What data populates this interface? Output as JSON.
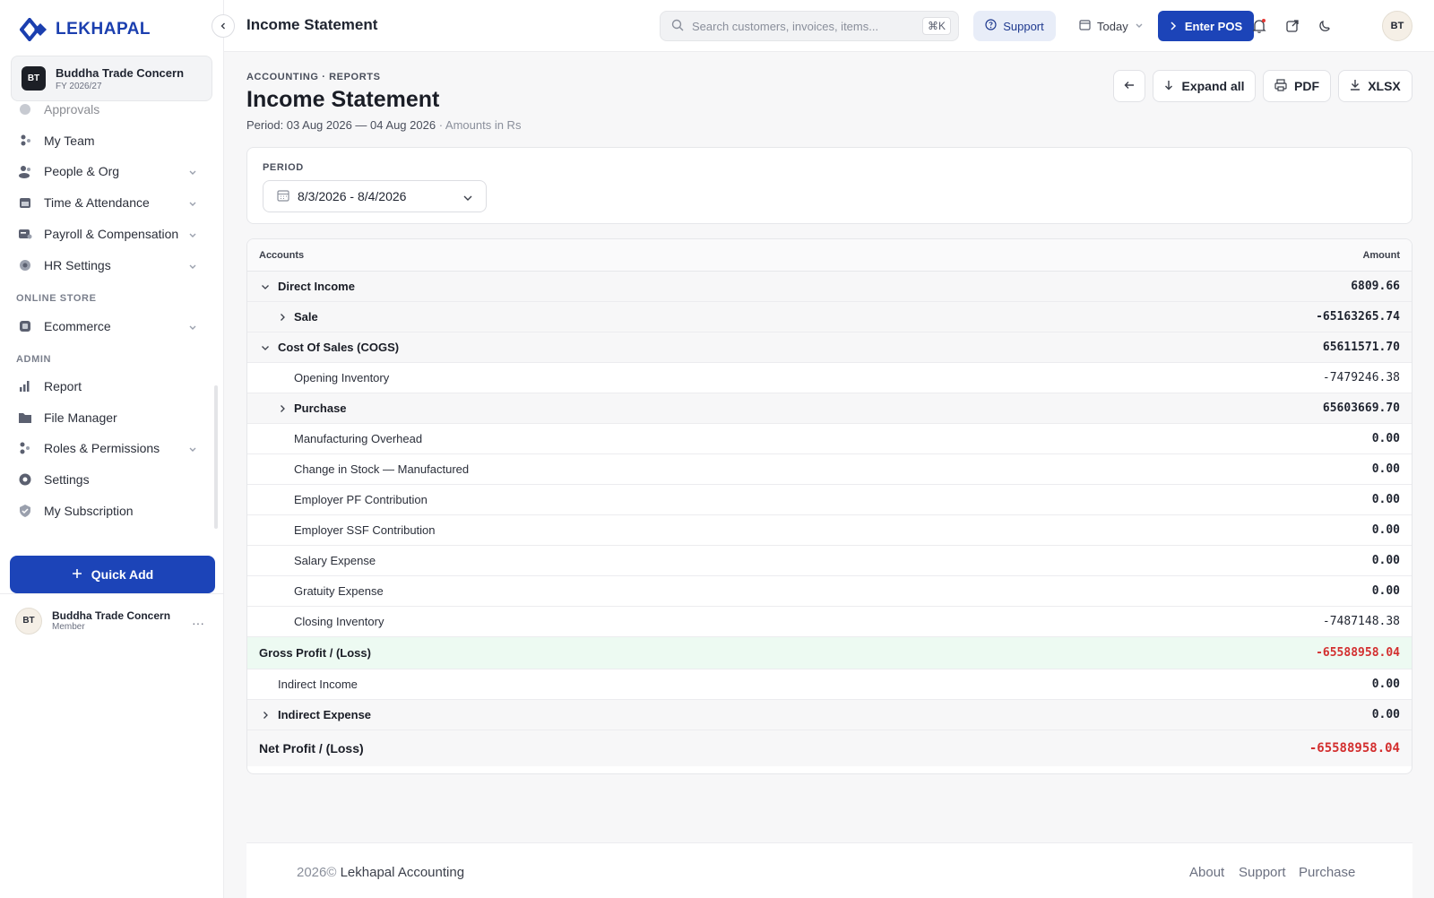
{
  "brand": {
    "logo_text": "LEKHAPAL",
    "primary_color": "#1c44b8"
  },
  "org": {
    "initials": "BT",
    "name": "Buddha Trade Concern",
    "fiscal_year": "FY 2026/27"
  },
  "sidebar": {
    "items": [
      {
        "label": "Approvals",
        "icon": "approvals-icon"
      },
      {
        "label": "My Team",
        "icon": "team-icon"
      },
      {
        "label": "People & Org",
        "icon": "people-icon",
        "has_children": true
      },
      {
        "label": "Time & Attendance",
        "icon": "calendar-icon",
        "has_children": true
      },
      {
        "label": "Payroll & Compensation",
        "icon": "payroll-icon",
        "has_children": true
      },
      {
        "label": "HR Settings",
        "icon": "gear-icon",
        "has_children": true
      },
      {
        "label": "Ecommerce",
        "icon": "store-icon",
        "has_children": true
      },
      {
        "label": "Report",
        "icon": "bar-chart-icon"
      },
      {
        "label": "File Manager",
        "icon": "folder-icon"
      },
      {
        "label": "Roles & Permissions",
        "icon": "roles-icon",
        "has_children": true
      },
      {
        "label": "Settings",
        "icon": "gear-icon"
      },
      {
        "label": "My Subscription",
        "icon": "shield-icon"
      }
    ],
    "sections": {
      "online_store": "ONLINE STORE",
      "admin": "ADMIN"
    },
    "quick_add_label": "Quick Add",
    "user": {
      "initials": "BT",
      "name": "Buddha Trade Concern",
      "role": "Member"
    }
  },
  "topbar": {
    "title": "Income Statement",
    "search_placeholder": "Search customers, invoices, items...",
    "search_shortcut": "⌘K",
    "support_label": "Support",
    "date_filter": "Today",
    "enter_pos_label": "Enter POS",
    "avatar_initials": "BT"
  },
  "page": {
    "breadcrumb": "ACCOUNTING · REPORTS",
    "title": "Income Statement",
    "period_text": "Period: 03 Aug 2026 — 04 Aug 2026",
    "amounts_note": "· Amounts in Rs",
    "buttons": {
      "expand_all": "Expand all",
      "pdf": "PDF",
      "xlsx": "XLSX"
    }
  },
  "filter": {
    "label": "PERIOD",
    "date_range": "8/3/2026 - 8/4/2026"
  },
  "table": {
    "headers": {
      "accounts": "Accounts",
      "amount": "Amount"
    },
    "rows": [
      {
        "label": "Direct Income",
        "amount": "6809.66",
        "level": 0,
        "toggle": "expanded",
        "bold": true
      },
      {
        "label": "Sale",
        "amount": "-65163265.74",
        "level": 1,
        "toggle": "collapsed",
        "bold": true
      },
      {
        "label": "Cost Of Sales (COGS)",
        "amount": "65611571.70",
        "level": 0,
        "toggle": "expanded",
        "bold": true
      },
      {
        "label": "Opening Inventory",
        "amount": "-7479246.38",
        "level": 2,
        "toggle": "none",
        "bold": false
      },
      {
        "label": "Purchase",
        "amount": "65603669.70",
        "level": 1,
        "toggle": "collapsed",
        "bold": true
      },
      {
        "label": "Manufacturing Overhead",
        "amount": "0.00",
        "level": 2,
        "toggle": "none",
        "bold": false,
        "amount_bold": true
      },
      {
        "label": "Change in Stock — Manufactured",
        "amount": "0.00",
        "level": 2,
        "toggle": "none",
        "bold": false,
        "amount_bold": true
      },
      {
        "label": "Employer PF Contribution",
        "amount": "0.00",
        "level": 2,
        "toggle": "none",
        "bold": false,
        "amount_bold": true
      },
      {
        "label": "Employer SSF Contribution",
        "amount": "0.00",
        "level": 2,
        "toggle": "none",
        "bold": false,
        "amount_bold": true
      },
      {
        "label": "Salary Expense",
        "amount": "0.00",
        "level": 2,
        "toggle": "none",
        "bold": false,
        "amount_bold": true
      },
      {
        "label": "Gratuity Expense",
        "amount": "0.00",
        "level": 2,
        "toggle": "none",
        "bold": false,
        "amount_bold": true
      },
      {
        "label": "Closing Inventory",
        "amount": "-7487148.38",
        "level": 2,
        "toggle": "none",
        "bold": false
      },
      {
        "label": "Gross Profit / (Loss)",
        "amount": "-65588958.04",
        "level": -1,
        "toggle": "none",
        "bold": true,
        "negative": true,
        "highlight": "green"
      },
      {
        "label": "Indirect Income",
        "amount": "0.00",
        "level": 1,
        "toggle": "none",
        "bold": false,
        "amount_bold": true,
        "flush": true
      },
      {
        "label": "Indirect Expense",
        "amount": "0.00",
        "level": 0,
        "toggle": "collapsed",
        "bold": true
      },
      {
        "label": "Net Profit / (Loss)",
        "amount": "-65588958.04",
        "level": -1,
        "toggle": "none",
        "bold": true,
        "negative": true,
        "total": true
      }
    ]
  },
  "footer": {
    "year": "2026©",
    "brand": "Lekhapal Accounting",
    "links": [
      "About",
      "Support",
      "Purchase"
    ]
  }
}
